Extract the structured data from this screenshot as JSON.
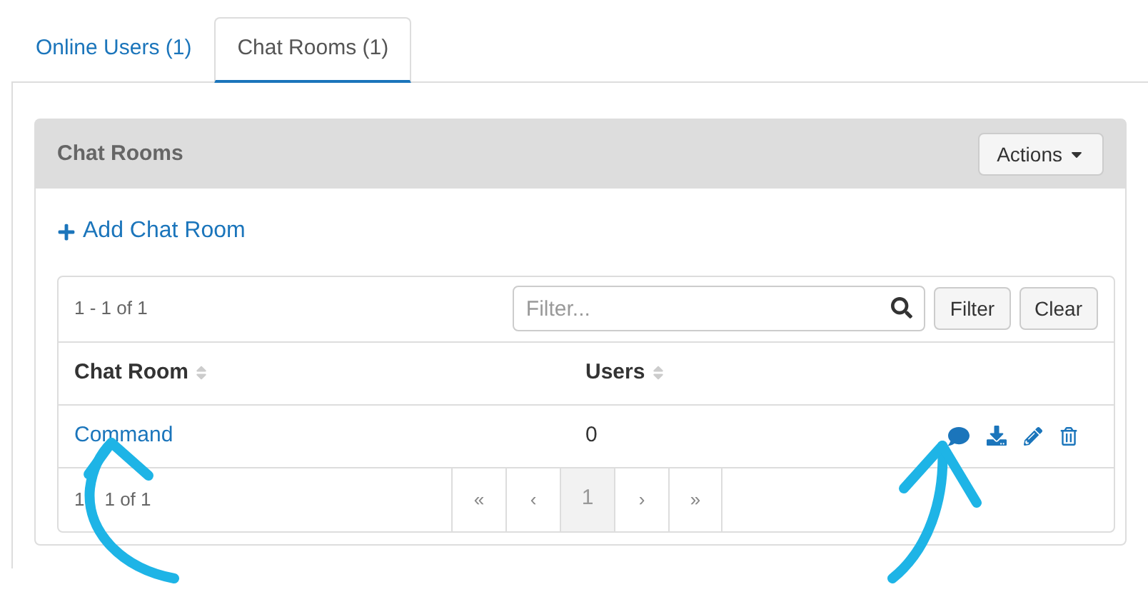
{
  "tabs": [
    {
      "label": "Online Users (1)",
      "selected": false
    },
    {
      "label": "Chat Rooms (1)",
      "selected": true
    }
  ],
  "panel": {
    "title": "Chat Rooms",
    "actions_button": "Actions",
    "add_link": "Add Chat Room"
  },
  "table": {
    "range_top": "1 - 1 of 1",
    "filter": {
      "placeholder": "Filter..."
    },
    "filter_button": "Filter",
    "clear_button": "Clear",
    "columns": [
      "Chat Room",
      "Users"
    ],
    "rows": [
      {
        "chat_room": "Command",
        "users": "0"
      }
    ],
    "range_bottom_visible": [
      "1",
      "1 of 1"
    ],
    "pagination": [
      {
        "label": "«",
        "selected": false
      },
      {
        "label": "‹",
        "selected": false
      },
      {
        "label": "1",
        "selected": true
      },
      {
        "label": "›",
        "selected": false
      },
      {
        "label": "»",
        "selected": false
      }
    ]
  }
}
